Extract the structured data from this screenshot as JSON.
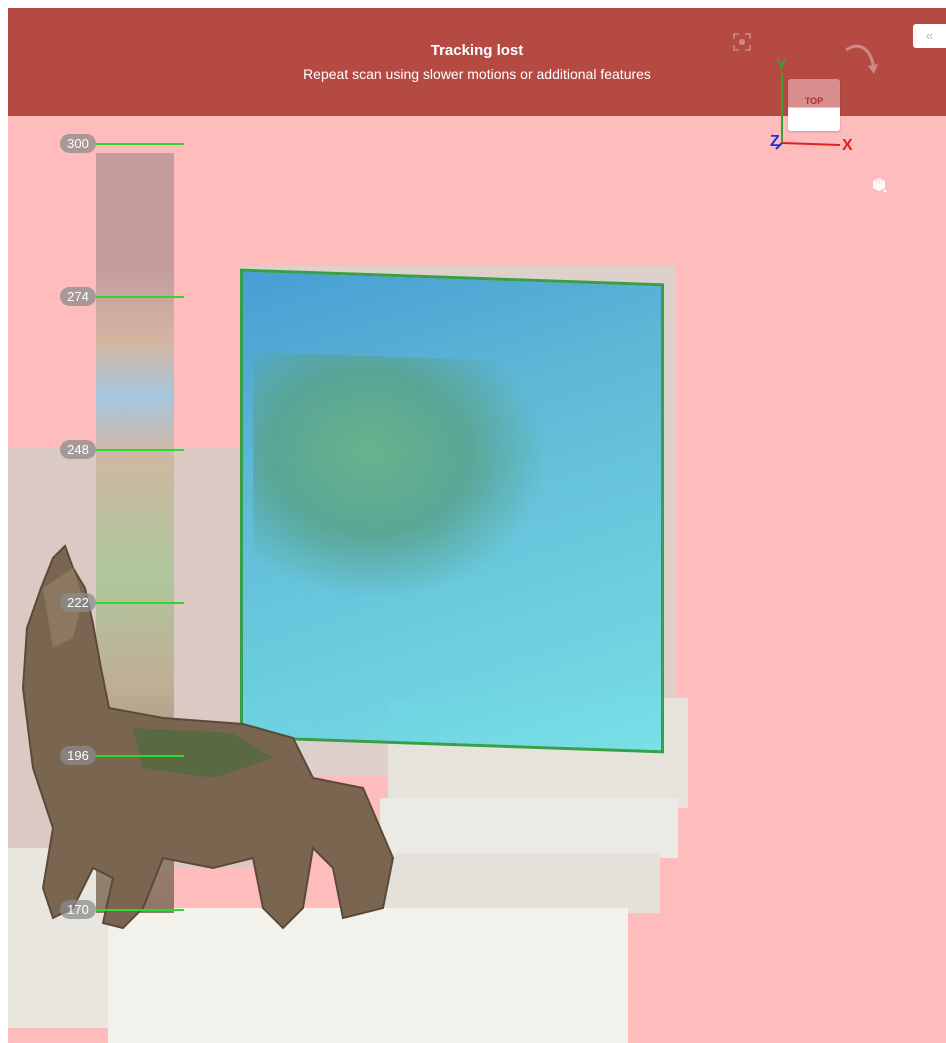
{
  "banner": {
    "title": "Tracking lost",
    "message": "Repeat scan using slower motions or additional features",
    "collapse_label": "«"
  },
  "ruler": {
    "ticks": [
      {
        "label": "300"
      },
      {
        "label": "274"
      },
      {
        "label": "248"
      },
      {
        "label": "222"
      },
      {
        "label": "196"
      },
      {
        "label": "170"
      }
    ]
  },
  "orientation": {
    "face_label": "TOP",
    "axis_x": "X",
    "axis_y": "Y",
    "axis_z": "Z",
    "colors": {
      "x": "#e0201c",
      "y": "#3aa02e",
      "z": "#1e32e0"
    }
  },
  "icons": {
    "collapse": "double-chevron-left-icon",
    "focus": "focus-target-icon",
    "rotate": "rotate-view-icon",
    "reset_cube": "reset-cube-icon"
  },
  "colors": {
    "banner_bg": "#b54a43",
    "viewport_bg": "#ffbcbc",
    "ruler_tick": "#2fd82f",
    "scan_outline": "#2a9b3c"
  }
}
